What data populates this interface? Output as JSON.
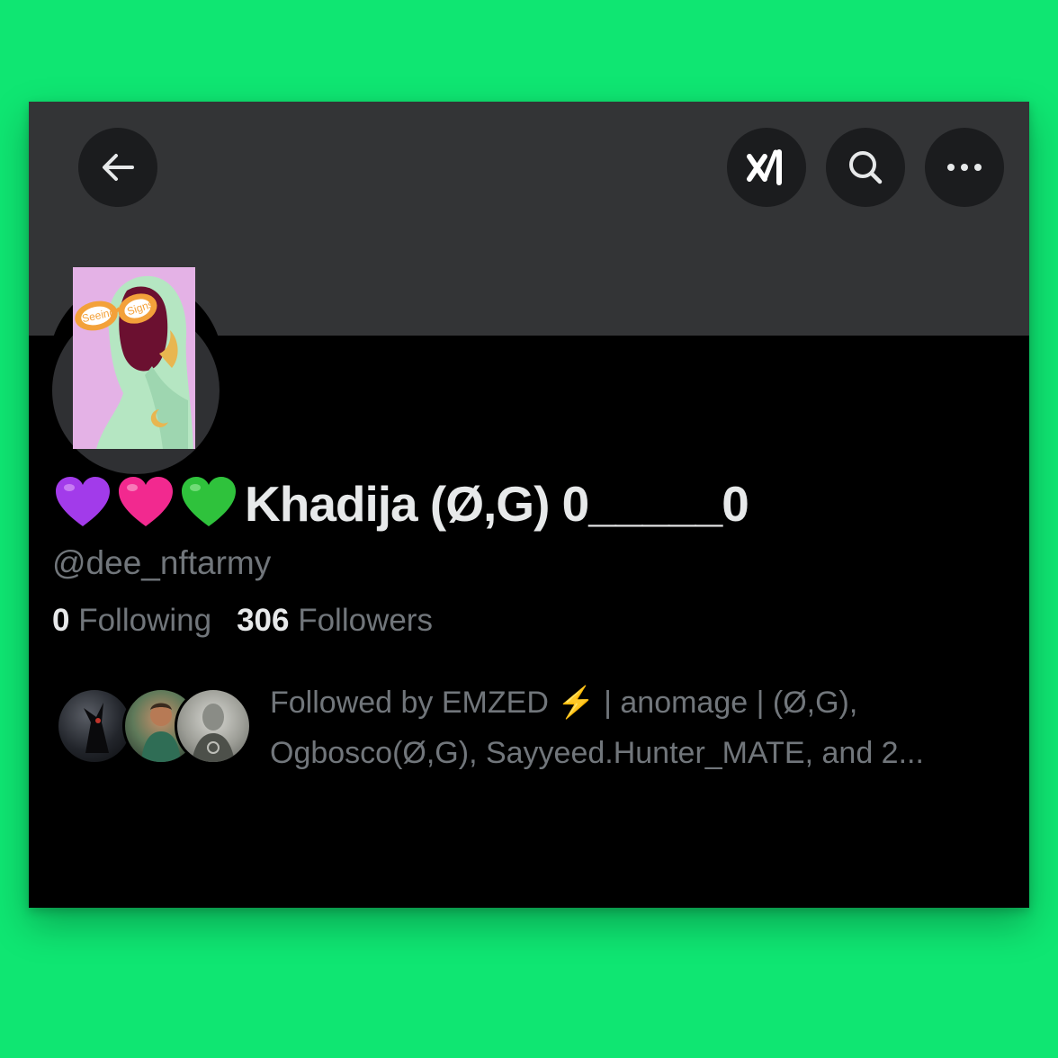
{
  "header": {
    "back_icon": "arrow-left-icon",
    "grok_icon": "grok-logo-icon",
    "search_icon": "search-icon",
    "more_icon": "more-horizontal-icon"
  },
  "profile": {
    "avatar_text_left": "Seeing",
    "avatar_text_right": "Signs",
    "hearts": [
      "💜",
      "💗",
      "💚"
    ],
    "display_name": "Khadija (Ø,G) 0_____0",
    "handle": "@dee_nftarmy",
    "following_count": "0",
    "following_label": "Following",
    "followers_count": "306",
    "followers_label": "Followers"
  },
  "followed_by": {
    "line1": "Followed by EMZED ⚡️  | anomage | (Ø,G),",
    "line2": "Ogbosco(Ø,G), Sayyeed.Hunter_MATE, and 2..."
  },
  "colors": {
    "page_background": "#0fe672",
    "banner": "#333436",
    "primary_text": "#e7e9ea",
    "secondary_text": "#71767b",
    "heart_purple": "#a23bea",
    "heart_pink": "#f2298f",
    "heart_green": "#2fc23c"
  }
}
